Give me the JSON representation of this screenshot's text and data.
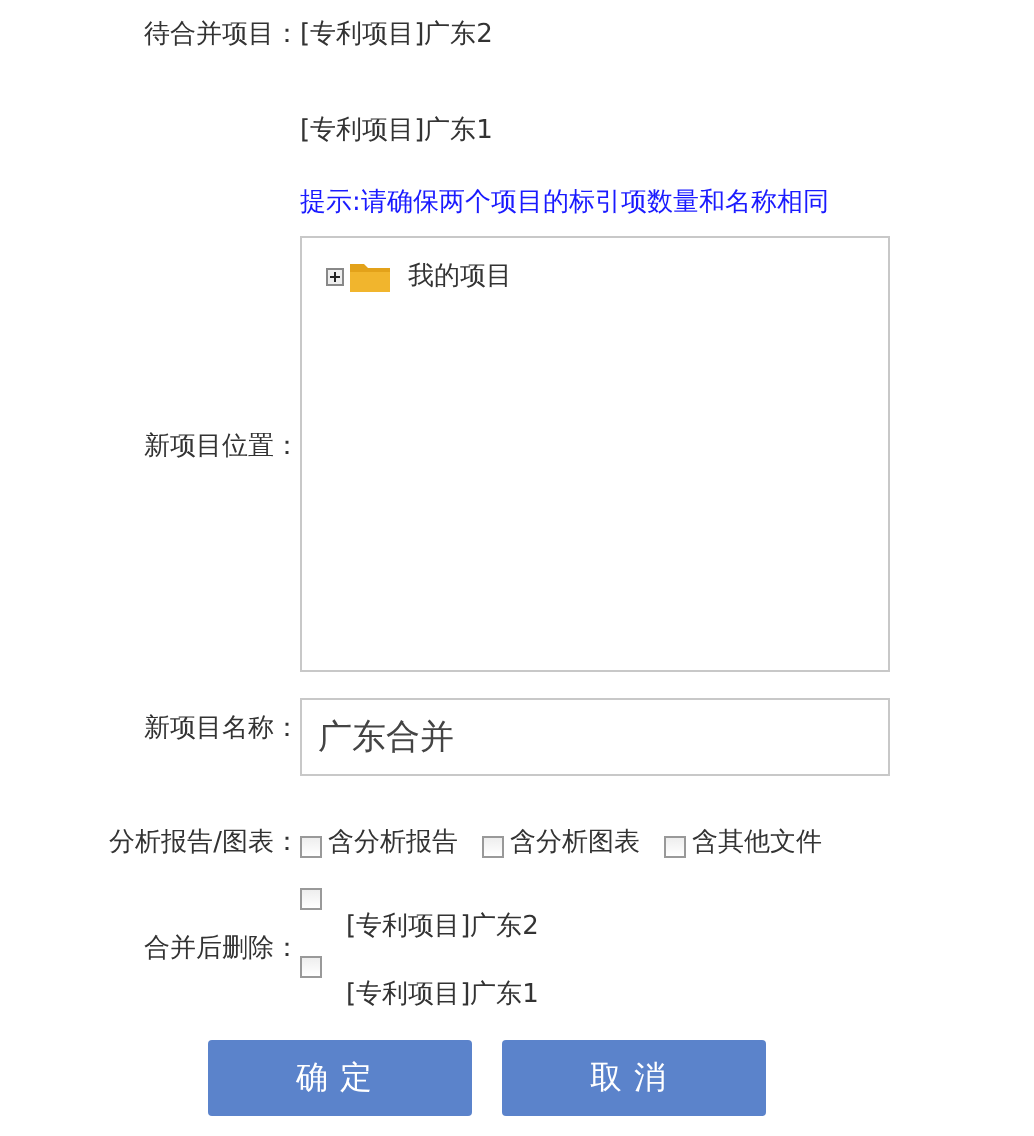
{
  "merge_items": {
    "label": "待合并项目：",
    "values": [
      "[专利项目]广东2",
      "[专利项目]广东1"
    ]
  },
  "hint": "提示:请确保两个项目的标引项数量和名称相同",
  "location": {
    "label": "新项目位置：",
    "tree": [
      {
        "label": "我的项目",
        "expanded": false
      }
    ]
  },
  "name": {
    "label": "新项目名称：",
    "value": "广东合并"
  },
  "reports": {
    "label": "分析报告/图表：",
    "options": [
      {
        "label": "含分析报告",
        "checked": false
      },
      {
        "label": "含分析图表",
        "checked": false
      },
      {
        "label": "含其他文件",
        "checked": false
      }
    ]
  },
  "delete_after": {
    "label": "合并后删除：",
    "options": [
      {
        "label": "[专利项目]广东2",
        "checked": false
      },
      {
        "label": "[专利项目]广东1",
        "checked": false
      }
    ]
  },
  "buttons": [
    "确定",
    "取消"
  ]
}
